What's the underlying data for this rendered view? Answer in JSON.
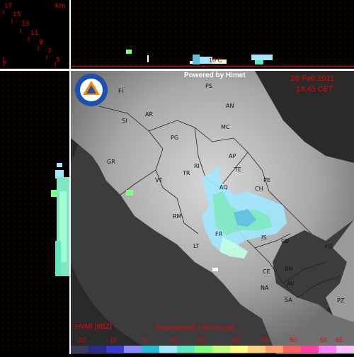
{
  "header": {
    "powered_by": "Powered by Himet",
    "date": "28 Feb 2011",
    "time": "13:45 CET"
  },
  "altitude_scale": {
    "unit": "Km",
    "labels": [
      "17",
      "15",
      "13",
      "11",
      "9",
      "7",
      "5"
    ]
  },
  "profile": {
    "freezing_tag": "10 C"
  },
  "legend": {
    "product": "HVMI [dBZ]",
    "freezing_level": "Freezing level  1.40 Km (asl)",
    "ticks": [
      "-20",
      "-10",
      "0",
      "10",
      "20",
      "30",
      "40",
      "50",
      "60",
      "65"
    ],
    "colors": [
      "#3a3a5a",
      "#2a2a8a",
      "#3a3ad0",
      "#8a8aff",
      "#28b8d8",
      "#a0e8ff",
      "#60e8c0",
      "#80ff80",
      "#c0ff80",
      "#ffff80",
      "#ffd080",
      "#ffa070",
      "#ff6060",
      "#ff40a0",
      "#ff80ff",
      "#ffc0ff"
    ]
  },
  "logo": {
    "text": "PROTEZIONE CIVILE"
  },
  "cities": [
    {
      "name": "PS"
    },
    {
      "name": "FI"
    },
    {
      "name": "AN"
    },
    {
      "name": "AR"
    },
    {
      "name": "SI"
    },
    {
      "name": "MC"
    },
    {
      "name": "PG"
    },
    {
      "name": "GR"
    },
    {
      "name": "AP"
    },
    {
      "name": "TE"
    },
    {
      "name": "TR"
    },
    {
      "name": "VT"
    },
    {
      "name": "RI"
    },
    {
      "name": "AQ"
    },
    {
      "name": "PE"
    },
    {
      "name": "CH"
    },
    {
      "name": "RM"
    },
    {
      "name": "FR"
    },
    {
      "name": "IS"
    },
    {
      "name": "CB"
    },
    {
      "name": "FG"
    },
    {
      "name": "LT"
    },
    {
      "name": "CE"
    },
    {
      "name": "BN"
    },
    {
      "name": "NA"
    },
    {
      "name": "AV"
    },
    {
      "name": "SA"
    },
    {
      "name": "PZ"
    }
  ]
}
